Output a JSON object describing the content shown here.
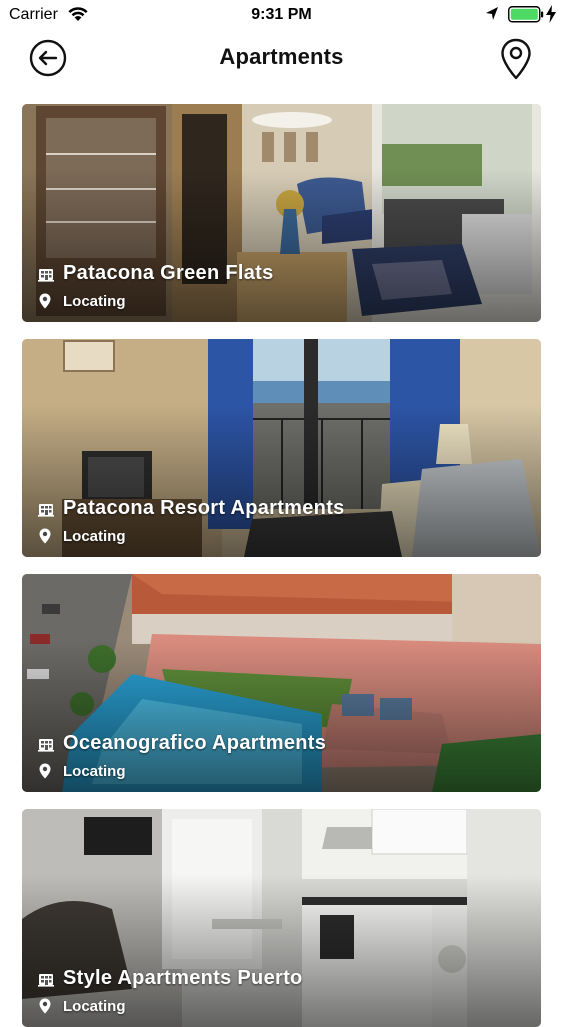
{
  "status_bar": {
    "carrier": "Carrier",
    "time": "9:31 PM",
    "icons": [
      "wifi-icon",
      "location-arrow-icon",
      "battery-icon",
      "charging-bolt-icon"
    ],
    "battery_color": "#4cd964"
  },
  "header": {
    "title": "Apartments",
    "back_icon": "back-arrow-circle-icon",
    "map_icon": "map-pin-icon"
  },
  "apartments": [
    {
      "name": "Patacona Green Flats",
      "location": "Locating"
    },
    {
      "name": "Patacona Resort Apartments",
      "location": "Locating"
    },
    {
      "name": "Oceanografico Apartments",
      "location": "Locating"
    },
    {
      "name": "Style Apartments Puerto",
      "location": "Locating"
    }
  ],
  "card_icons": {
    "name_icon": "building-icon",
    "location_icon": "location-pin-icon"
  }
}
